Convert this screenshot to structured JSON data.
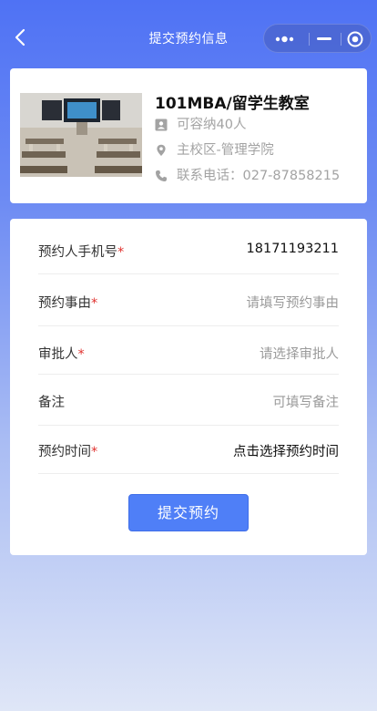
{
  "nav": {
    "title": "提交预约信息",
    "back_icon": "chevron-left-icon",
    "capsule_icons": [
      "more-dots-icon",
      "minimize-icon",
      "target-icon"
    ]
  },
  "room": {
    "name": "101MBA/留学生教室",
    "capacity": "可容纳40人",
    "location": "主校区-管理学院",
    "phone": "联系电话：027-87858215",
    "icons": {
      "capacity": "contact-card-icon",
      "location": "location-pin-icon",
      "phone": "phone-icon"
    }
  },
  "form": {
    "fields": [
      {
        "label": "预约人手机号",
        "required": "*",
        "value": "18171193211",
        "placeholder": ""
      },
      {
        "label": "预约事由",
        "required": "*",
        "value": "",
        "placeholder": "请填写预约事由"
      },
      {
        "label": "审批人",
        "required": "*",
        "value": "",
        "placeholder": "请选择审批人"
      },
      {
        "label": "备注",
        "required": "",
        "value": "",
        "placeholder": "可填写备注"
      },
      {
        "label": "预约时间",
        "required": "*",
        "value": "点击选择预约时间",
        "placeholder": ""
      }
    ],
    "submit_label": "提交预约"
  },
  "colors": {
    "primary": "#4f7ff7",
    "required": "#e0322f",
    "placeholder": "#9a9a9a"
  }
}
